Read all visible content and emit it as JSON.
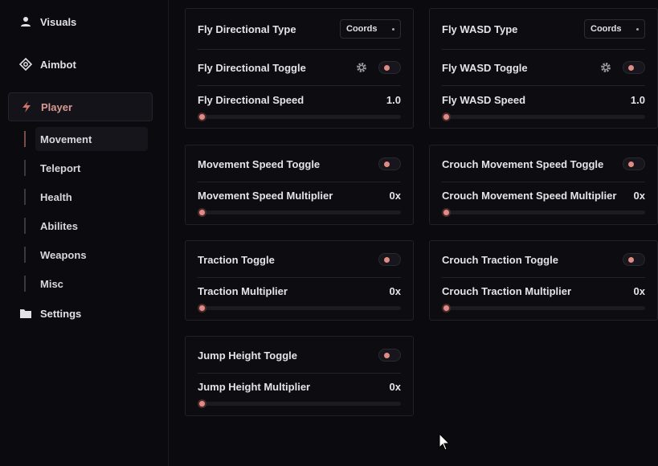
{
  "sidebar": {
    "items": [
      {
        "label": "Visuals",
        "icon": "user-icon"
      },
      {
        "label": "Aimbot",
        "icon": "crosshair-icon"
      },
      {
        "label": "Player",
        "icon": "lightning-icon",
        "active": true
      },
      {
        "label": "Settings",
        "icon": "folder-icon"
      }
    ],
    "sub_items": [
      {
        "label": "Movement",
        "active": true
      },
      {
        "label": "Teleport"
      },
      {
        "label": "Health"
      },
      {
        "label": "Abilites"
      },
      {
        "label": "Weapons"
      },
      {
        "label": "Misc"
      }
    ]
  },
  "panels": {
    "fly_directional": {
      "type_label": "Fly Directional Type",
      "type_value": "Coords",
      "toggle_label": "Fly Directional Toggle",
      "speed_label": "Fly Directional Speed",
      "speed_value": "1.0"
    },
    "fly_wasd": {
      "type_label": "Fly WASD Type",
      "type_value": "Coords",
      "toggle_label": "Fly WASD Toggle",
      "speed_label": "Fly WASD Speed",
      "speed_value": "1.0"
    },
    "movement_speed": {
      "toggle_label": "Movement Speed Toggle",
      "multiplier_label": "Movement Speed Multiplier",
      "multiplier_value": "0x"
    },
    "crouch_movement_speed": {
      "toggle_label": "Crouch Movement Speed Toggle",
      "multiplier_label": "Crouch Movement Speed Multiplier",
      "multiplier_value": "0x"
    },
    "traction": {
      "toggle_label": "Traction Toggle",
      "multiplier_label": "Traction Multiplier",
      "multiplier_value": "0x"
    },
    "crouch_traction": {
      "toggle_label": "Crouch Traction Toggle",
      "multiplier_label": "Crouch Traction Multiplier",
      "multiplier_value": "0x"
    },
    "jump_height": {
      "toggle_label": "Jump Height Toggle",
      "multiplier_label": "Jump Height Multiplier",
      "multiplier_value": "0x"
    }
  },
  "colors": {
    "accent": "#e08b86",
    "background": "#0b0a0f",
    "panel_border": "#222127"
  }
}
